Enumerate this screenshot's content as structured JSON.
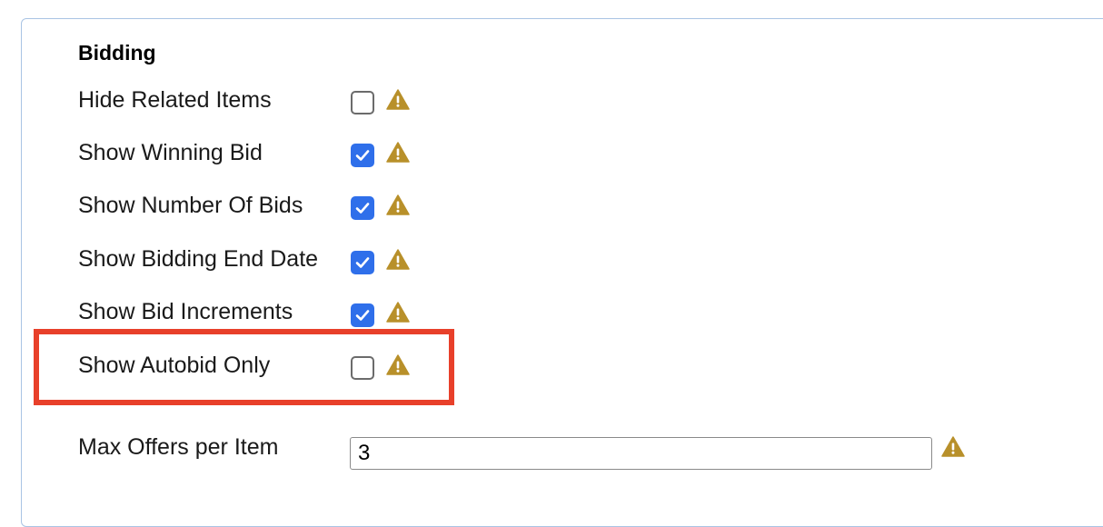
{
  "section": {
    "title": "Bidding"
  },
  "options": [
    {
      "label": "Hide Related Items",
      "checked": false
    },
    {
      "label": "Show Winning Bid",
      "checked": true
    },
    {
      "label": "Show Number Of Bids",
      "checked": true
    },
    {
      "label": "Show Bidding End Date",
      "checked": true
    },
    {
      "label": "Show Bid Increments",
      "checked": true
    },
    {
      "label": "Show Autobid Only",
      "checked": false
    }
  ],
  "max_offers": {
    "label": "Max Offers per Item",
    "value": "3"
  },
  "colors": {
    "checkbox_checked": "#2f6fea",
    "warning_icon": "#b8902a",
    "highlight_border": "#e8402a",
    "panel_border": "#a9c4e4"
  },
  "icons": {
    "warning": "warning-triangle-icon",
    "check": "checkmark-icon"
  }
}
